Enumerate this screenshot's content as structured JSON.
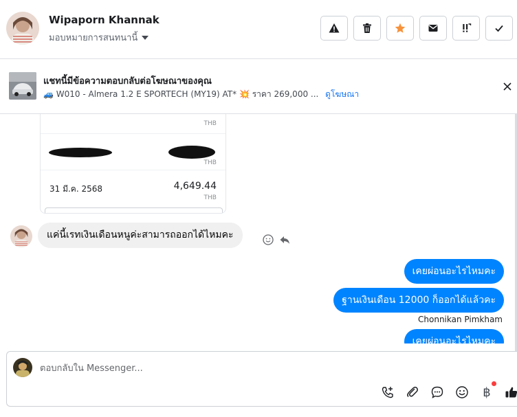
{
  "header": {
    "contact_name": "Wipaporn Khannak",
    "assign_label": "มอบหมายการสนทนานี้",
    "actions": [
      {
        "name": "spam-button",
        "icon": "warning-icon"
      },
      {
        "name": "delete-button",
        "icon": "trash-icon"
      },
      {
        "name": "star-button",
        "icon": "star-icon",
        "color": "#f7923b"
      },
      {
        "name": "mark-unread-button",
        "icon": "envelope-icon"
      },
      {
        "name": "follow-up-button",
        "icon": "exclamation-icon"
      },
      {
        "name": "mark-done-button",
        "icon": "checkmark-icon"
      }
    ]
  },
  "ad_banner": {
    "title": "แชทนี้มีข้อความตอบกลับต่อโฆษณาของคุณ",
    "description": "🚙 W010 - Almera 1.2 E SPORTECH (MY19) AT* 💥 ราคา 269,000 ...",
    "link_label": "ดูโฆษณา"
  },
  "attachment": {
    "rows": [
      {
        "date": "",
        "amount": "",
        "currency": "THB"
      },
      {
        "date": "",
        "amount": "",
        "currency": "THB"
      },
      {
        "date": "31 มี.ค. 2568",
        "amount": "4,649.44",
        "currency": "THB"
      }
    ]
  },
  "messages": {
    "incoming_text": "แค่นี้เรทเงินเดือนหนูค่ะสามารถออกได้ไหมคะ",
    "outgoing": [
      "เคยผ่อนอะไรไหมคะ",
      "ฐานเงินเดือน 12000 ก็ออกได้แล้วคะ",
      "เคยผ่อนอะไรไหมคะ"
    ],
    "sender_name": "Chonnikan Pimkham"
  },
  "composer": {
    "placeholder": "ตอบกลับใน Messenger..."
  },
  "colors": {
    "accent": "#0084ff",
    "link": "#1877f2",
    "star": "#f7923b"
  }
}
